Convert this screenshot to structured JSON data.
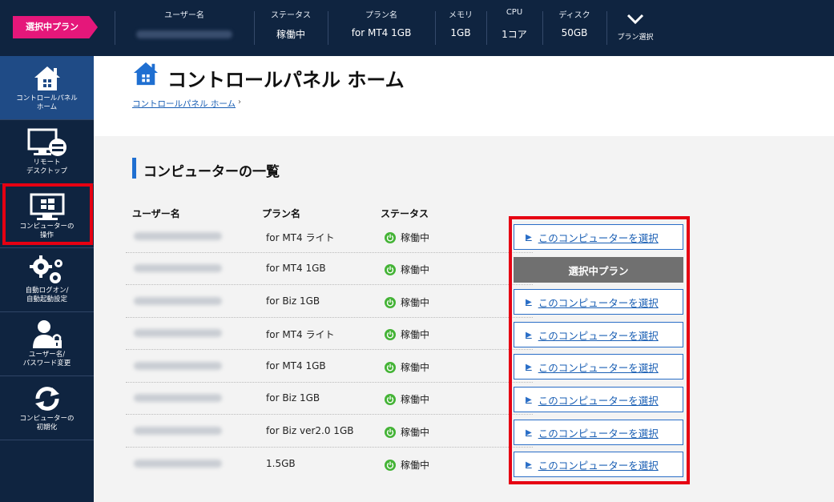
{
  "topbar": {
    "plan_tag": "選択中プラン",
    "username_label": "ユーザー名",
    "status_label": "ステータス",
    "status_value": "稼働中",
    "plan_label": "プラン名",
    "plan_value": "for MT4 1GB",
    "memory_label": "メモリ",
    "memory_value": "1GB",
    "cpu_label": "CPU",
    "cpu_value": "1コア",
    "disk_label": "ディスク",
    "disk_value": "50GB",
    "plan_select": "プラン選択"
  },
  "sidebar": {
    "items": [
      {
        "label1": "コントロールパネル",
        "label2": "ホーム",
        "icon": "home-icon"
      },
      {
        "label1": "リモート",
        "label2": "デスクトップ",
        "icon": "monitor-icon"
      },
      {
        "label1": "コンピューターの",
        "label2": "操作",
        "icon": "windows-monitor-icon"
      },
      {
        "label1": "自動ログオン/",
        "label2": "自動起動設定",
        "icon": "gears-icon"
      },
      {
        "label1": "ユーザー名/",
        "label2": "パスワード変更",
        "icon": "user-lock-icon"
      },
      {
        "label1": "コンピューターの",
        "label2": "初期化",
        "icon": "refresh-icon"
      }
    ]
  },
  "page": {
    "title": "コントロールパネル ホーム",
    "breadcrumb": "コントロールパネル ホーム",
    "section_title": "コンピューターの一覧"
  },
  "table": {
    "headers": [
      "ユーザー名",
      "プラン名",
      "ステータス"
    ],
    "select_label": "このコンピューターを選択",
    "current_label": "選択中プラン",
    "rows": [
      {
        "plan": "for MT4 ライト",
        "status": "稼働中"
      },
      {
        "plan": "for MT4 1GB",
        "status": "稼働中"
      },
      {
        "plan": "for Biz 1GB",
        "status": "稼働中"
      },
      {
        "plan": "for MT4 ライト",
        "status": "稼働中"
      },
      {
        "plan": "for MT4 1GB",
        "status": "稼働中"
      },
      {
        "plan": "for Biz 1GB",
        "status": "稼働中"
      },
      {
        "plan": "for Biz ver2.0 1GB",
        "status": "稼働中"
      },
      {
        "plan": "1.5GB",
        "status": "稼働中"
      }
    ]
  },
  "colors": {
    "navy": "#0f2440",
    "accent_pink": "#e5177a",
    "highlight_red": "#e60012",
    "status_green": "#44b336",
    "link_blue": "#1a5fb4"
  }
}
